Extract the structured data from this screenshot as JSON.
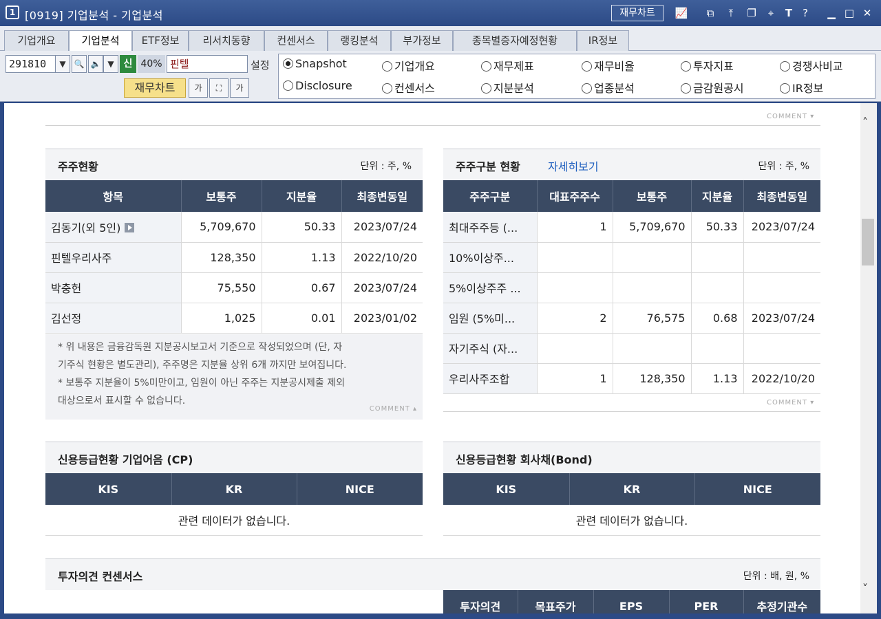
{
  "window": {
    "number": "1",
    "title": "[0919] 기업분석 - 기업분석",
    "chart_button": "재무차트"
  },
  "tabs": [
    {
      "label": "기업개요"
    },
    {
      "label": "기업분석"
    },
    {
      "label": "ETF정보"
    },
    {
      "label": "리서치동향"
    },
    {
      "label": "컨센서스"
    },
    {
      "label": "랭킹분석"
    },
    {
      "label": "부가정보"
    },
    {
      "label": "종목별증자예정현황"
    },
    {
      "label": "IR정보"
    }
  ],
  "toolbar": {
    "code": "291810",
    "credit_badge": "신",
    "margin_rate": "40%",
    "stock_name": "핀텔",
    "setting_label": "설정",
    "fin_chart_button": "재무차트",
    "font_btn_1": "가",
    "font_btn_2": "가"
  },
  "radios": [
    {
      "label": "Snapshot",
      "checked": true
    },
    {
      "label": "기업개요"
    },
    {
      "label": "재무제표"
    },
    {
      "label": "재무비율"
    },
    {
      "label": "투자지표"
    },
    {
      "label": "경쟁사비교"
    },
    {
      "label": "Disclosure"
    },
    {
      "label": "컨센서스"
    },
    {
      "label": "지분분석"
    },
    {
      "label": "업종분석"
    },
    {
      "label": "금감원공시"
    },
    {
      "label": "IR정보"
    }
  ],
  "comment_label": "COMMENT",
  "shareholders": {
    "title": "주주현황",
    "unit": "단위 : 주, %",
    "headers": [
      "항목",
      "보통주",
      "지분율",
      "최종변동일"
    ],
    "rows": [
      [
        "김동기(외 5인)",
        "5,709,670",
        "50.33",
        "2023/07/24"
      ],
      [
        "핀텔우리사주",
        "128,350",
        "1.13",
        "2022/10/20"
      ],
      [
        "박충헌",
        "75,550",
        "0.67",
        "2023/07/24"
      ],
      [
        "김선정",
        "1,025",
        "0.01",
        "2023/01/02"
      ]
    ],
    "note": "* 위 내용은 금융감독원 지분공시보고서 기준으로 작성되었으며 (단, 자기주식 현황은 별도관리), 주주명은 지분율 상위 6개 까지만 보여집니다. * 보통주 지분율이 5%미만이고, 임원이 아닌 주주는 지분공시제출 제외 대상으로서 표시할 수 없습니다.",
    "note_line1": "* 위 내용은 금융감독원 지분공시보고서 기준으로 작성되었으며 (단, 자",
    "note_line2": "기주식 현황은 별도관리), 주주명은 지분율 상위 6개 까지만 보여집니다.",
    "note_line3": "* 보통주 지분율이 5%미만이고, 임원이 아닌 주주는 지분공시제출 제외",
    "note_line4": "대상으로서 표시할 수 없습니다."
  },
  "shareholder_types": {
    "title": "주주구분 현황",
    "detail_link": "자세히보기",
    "unit": "단위 : 주, %",
    "headers": [
      "주주구분",
      "대표주주수",
      "보통주",
      "지분율",
      "최종변동일"
    ],
    "rows": [
      [
        "최대주주등 (...",
        "1",
        "5,709,670",
        "50.33",
        "2023/07/24"
      ],
      [
        "10%이상주...",
        "",
        "",
        "",
        ""
      ],
      [
        "5%이상주주 ...",
        "",
        "",
        "",
        ""
      ],
      [
        "임원 (5%미...",
        "2",
        "76,575",
        "0.68",
        "2023/07/24"
      ],
      [
        "자기주식 (자...",
        "",
        "",
        "",
        ""
      ],
      [
        "우리사주조합",
        "1",
        "128,350",
        "1.13",
        "2022/10/20"
      ]
    ]
  },
  "credit_cp": {
    "title": "신용등급현황 기업어음 (CP)",
    "headers": [
      "KIS",
      "KR",
      "NICE"
    ],
    "no_data": "관련 데이터가 없습니다."
  },
  "credit_bond": {
    "title": "신용등급현황 회사채(Bond)",
    "headers": [
      "KIS",
      "KR",
      "NICE"
    ],
    "no_data": "관련 데이터가 없습니다."
  },
  "consensus": {
    "title": "투자의견 컨센서스",
    "unit": "단위 : 배, 원, %",
    "headers": [
      "투자의견",
      "목표주가",
      "EPS",
      "PER",
      "추정기관수"
    ]
  }
}
